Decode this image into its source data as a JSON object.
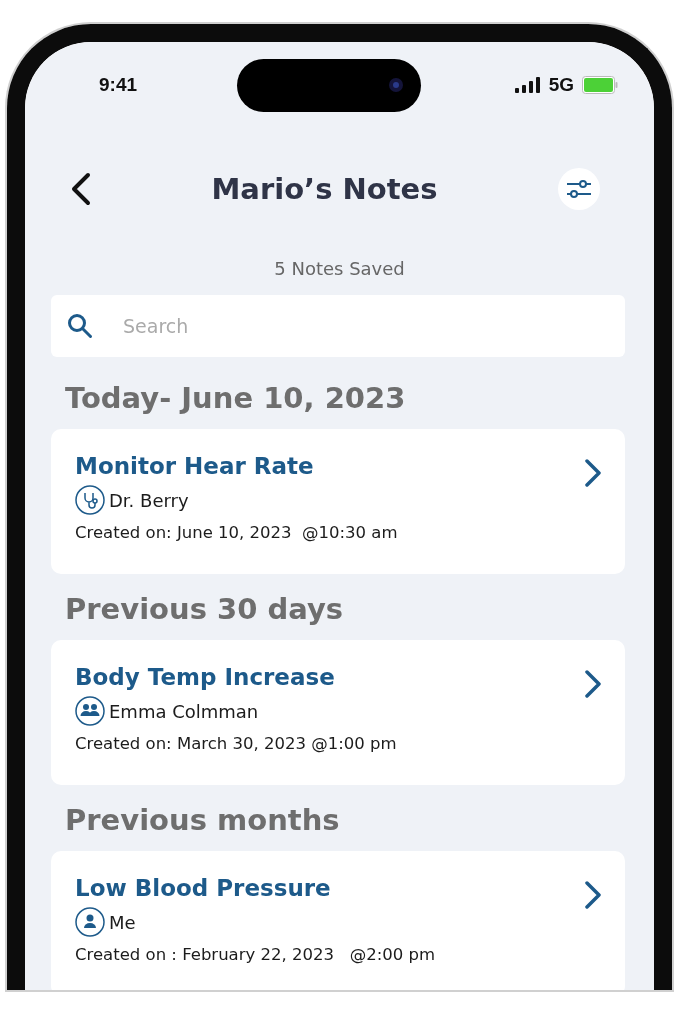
{
  "status_bar": {
    "time": "9:41",
    "network": "5G"
  },
  "header": {
    "title": "Mario’s Notes",
    "subtitle": "5 Notes Saved"
  },
  "search": {
    "placeholder": "Search"
  },
  "sections": [
    {
      "heading": "Today- June 10, 2023",
      "notes": [
        {
          "title": "Monitor Hear Rate",
          "author": "Dr. Berry",
          "kind": "doctor",
          "created": "Created on: June 10, 2023  @10:30 am"
        }
      ]
    },
    {
      "heading": "Previous 30 days",
      "notes": [
        {
          "title": "Body Temp Increase",
          "author": "Emma Colmman",
          "kind": "group",
          "created": "Created on: March 30, 2023 @1:00 pm"
        }
      ]
    },
    {
      "heading": "Previous months",
      "notes": [
        {
          "title": "Low Blood Pressure",
          "author": "Me",
          "kind": "person",
          "created": "Created on : February 22, 2023   @2:00 pm"
        }
      ]
    }
  ]
}
